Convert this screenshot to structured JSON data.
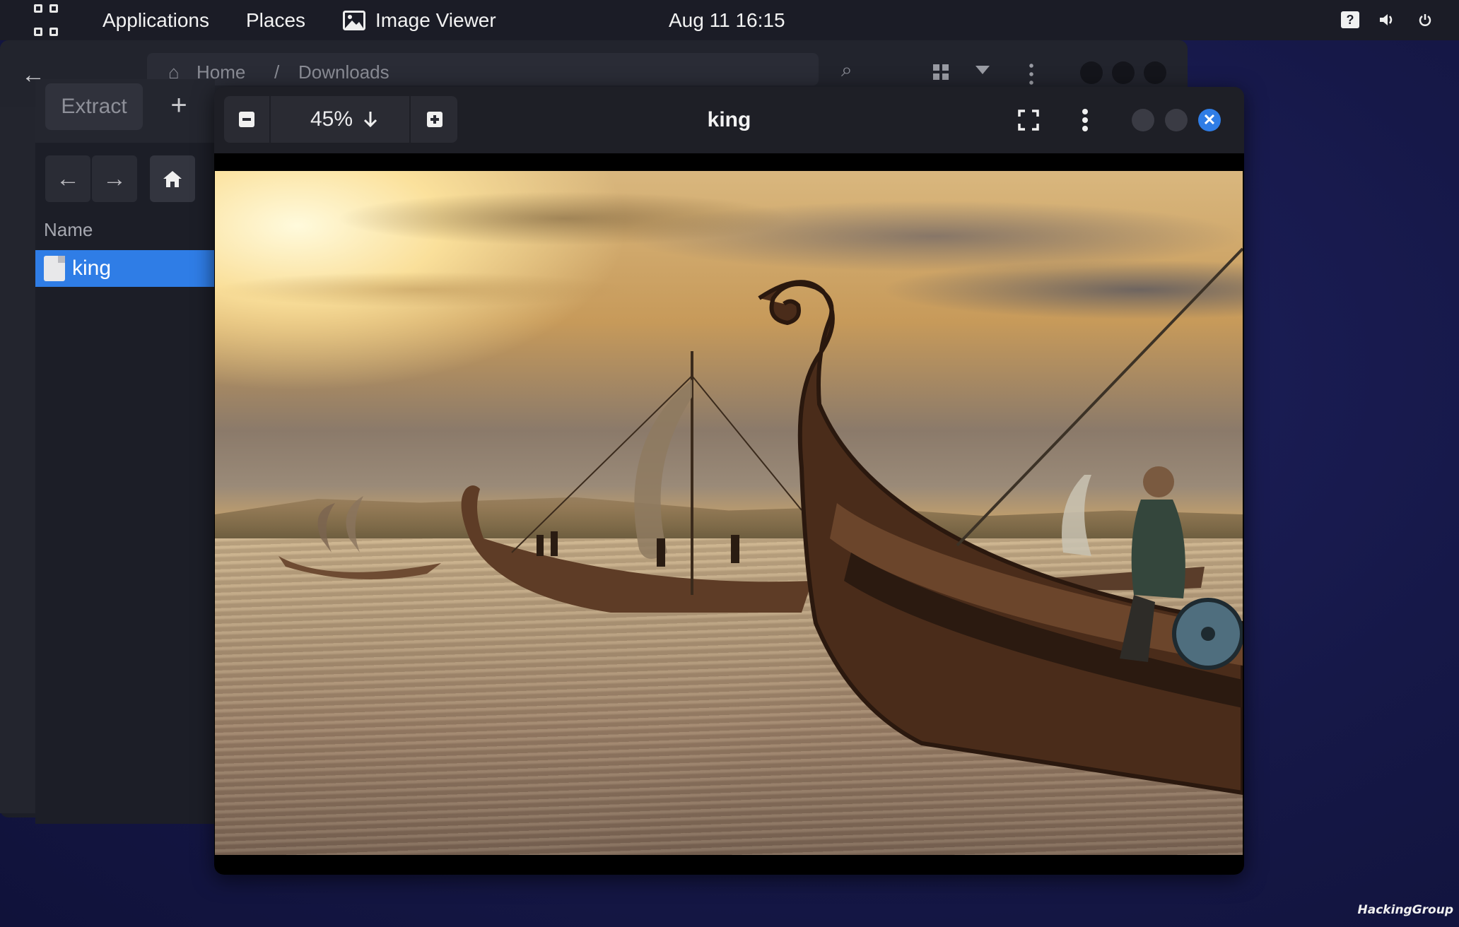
{
  "topbar": {
    "activities_icon": "apps-grid-icon",
    "applications": "Applications",
    "places": "Places",
    "app_name": "Image Viewer",
    "app_icon": "image-viewer-icon",
    "clock": "Aug 11  16:15",
    "tray_icons": [
      "help-icon",
      "volume-icon",
      "power-icon"
    ]
  },
  "file_manager": {
    "path_home": "Home",
    "path_sep": "/",
    "path_current": "Downloads"
  },
  "archive_panel": {
    "extract_label": "Extract",
    "add_label": "+",
    "column_name": "Name",
    "files": [
      {
        "name": "king",
        "selected": true
      }
    ]
  },
  "viewer": {
    "title": "king",
    "zoom": "45%",
    "accent": "#2f7de6"
  },
  "watermark": "HackingGroup"
}
